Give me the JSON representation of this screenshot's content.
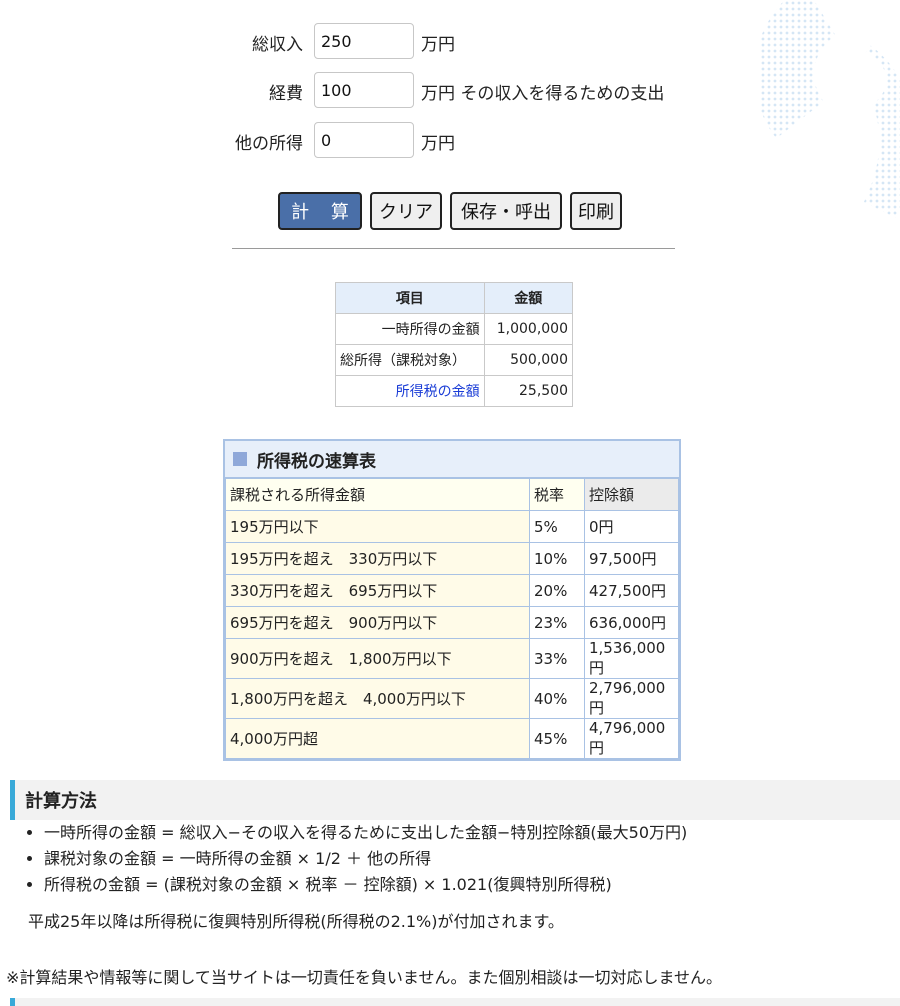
{
  "form": {
    "income": {
      "label": "総収入",
      "value": "250",
      "unit": "万円"
    },
    "expense": {
      "label": "経費",
      "value": "100",
      "unit": "万円 その収入を得るための支出"
    },
    "other": {
      "label": "他の所得",
      "value": "0",
      "unit": "万円"
    }
  },
  "buttons": {
    "calc": "計 算",
    "clear": "クリア",
    "save": "保存・呼出",
    "print": "印刷"
  },
  "result": {
    "headers": [
      "項目",
      "金額"
    ],
    "rows": [
      {
        "item": "一時所得の金額",
        "amount": "1,000,000"
      },
      {
        "item": "総所得（課税対象）",
        "amount": "500,000"
      },
      {
        "item": "所得税の金額",
        "amount": "25,500"
      }
    ]
  },
  "rate_table": {
    "title": "所得税の速算表",
    "headers": [
      "課税される所得金額",
      "税率",
      "控除額"
    ],
    "rows": [
      {
        "range": "195万円以下",
        "rate": "5%",
        "deduction": "0円"
      },
      {
        "range": "195万円を超え　330万円以下",
        "rate": "10%",
        "deduction": "97,500円"
      },
      {
        "range": "330万円を超え　695万円以下",
        "rate": "20%",
        "deduction": "427,500円"
      },
      {
        "range": "695万円を超え　900万円以下",
        "rate": "23%",
        "deduction": "636,000円"
      },
      {
        "range": "900万円を超え　1,800万円以下",
        "rate": "33%",
        "deduction": "1,536,000円"
      },
      {
        "range": "1,800万円を超え　4,000万円以下",
        "rate": "40%",
        "deduction": "2,796,000円"
      },
      {
        "range": "4,000万円超",
        "rate": "45%",
        "deduction": "4,796,000円"
      }
    ]
  },
  "method": {
    "title": "計算方法",
    "items": [
      "一時所得の金額 = 総収入−その収入を得るために支出した金額−特別控除額(最大50万円)",
      "課税対象の金額 = 一時所得の金額 × 1/2 ＋ 他の所得",
      "所得税の金額 = (課税対象の金額 × 税率 － 控除額) × 1.021(復興特別所得税)"
    ],
    "note": "平成25年以降は所得税に復興特別所得税(所得税の2.1%)が付加されます。"
  },
  "disclaimer": "※計算結果や情報等に関して当サイトは一切責任を負いません。また個別相談は一切対応しません。",
  "colors": {
    "primary_button": "#4a6fa8",
    "accent": "#39a9d8",
    "link_blue": "#1a3cd6",
    "table_border": "#a9c2e4"
  }
}
